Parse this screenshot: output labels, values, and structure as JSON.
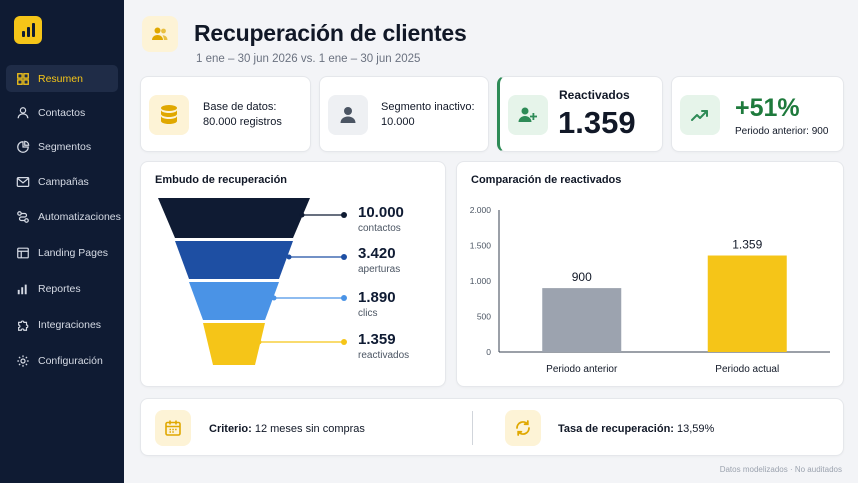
{
  "sidebar": {
    "items": [
      {
        "label": "Resumen",
        "icon": "grid-icon"
      },
      {
        "label": "Contactos",
        "icon": "user-icon"
      },
      {
        "label": "Segmentos",
        "icon": "pie-icon"
      },
      {
        "label": "Campañas",
        "icon": "mail-icon"
      },
      {
        "label": "Automatizaciones",
        "icon": "flow-icon"
      },
      {
        "label": "Landing Pages",
        "icon": "layout-icon"
      },
      {
        "label": "Reportes",
        "icon": "bar-chart-icon"
      },
      {
        "label": "Integraciones",
        "icon": "puzzle-icon"
      },
      {
        "label": "Configuración",
        "icon": "gear-icon"
      }
    ]
  },
  "header": {
    "title": "Recuperación de clientes",
    "subtitle": "1 ene – 30 jun 2026 vs. 1 ene – 30 jun 2025"
  },
  "stats": {
    "database": {
      "label": "Base de datos:",
      "value": "80.000 registros"
    },
    "segment": {
      "label": "Segmento inactivo:",
      "value": "10.000"
    },
    "reactivated": {
      "label": "Reactivados",
      "value": "1.359"
    },
    "growth": {
      "value": "+51%",
      "note": "Periodo anterior: 900"
    }
  },
  "funnel": {
    "title": "Embudo de recuperación",
    "stages": [
      {
        "value": "10.000",
        "label": "contactos",
        "color": "#0f1b33"
      },
      {
        "value": "3.420",
        "label": "aperturas",
        "color": "#1e4fa3"
      },
      {
        "value": "1.890",
        "label": "clics",
        "color": "#4a93e6"
      },
      {
        "value": "1.359",
        "label": "reactivados",
        "color": "#f5c518"
      }
    ]
  },
  "comparison": {
    "title": "Comparación de reactivados"
  },
  "chart_data": {
    "type": "bar",
    "title": "Comparación de reactivados",
    "categories": [
      "Periodo anterior",
      "Periodo actual"
    ],
    "values": [
      900,
      1359
    ],
    "value_labels": [
      "900",
      "1.359"
    ],
    "colors": [
      "#9ca3af",
      "#f5c518"
    ],
    "ylim": [
      0,
      2000
    ],
    "yticks": [
      "0",
      "500",
      "1.000",
      "1.500",
      "2.000"
    ],
    "grid": false
  },
  "footer": {
    "criterion_label": "Criterio:",
    "criterion_value": "12 meses sin compras",
    "rate_label": "Tasa de recuperación:",
    "rate_value": "13,59%",
    "note": "Datos modelizados · No auditados"
  },
  "colors": {
    "accent": "#f5c518",
    "success": "#1e7a3c",
    "sidebar": "#0f1b33"
  }
}
